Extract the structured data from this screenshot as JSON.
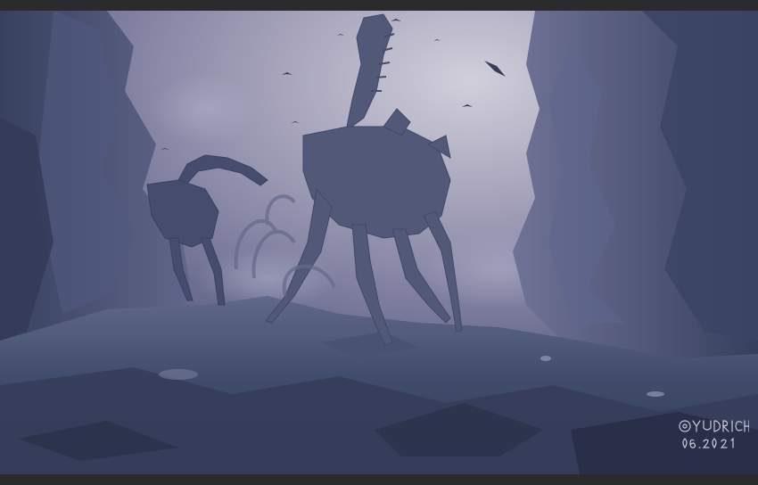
{
  "artwork": {
    "signature_handle": "@YUDRICH",
    "signature_date": "06.2021"
  },
  "colors": {
    "frame": "#2b2b2d",
    "sky_light": "#b9b6c8",
    "sky_mid": "#8784a0",
    "cliff_dark": "#3c4564",
    "ground_dark": "#2c3552",
    "creature": "#4a5070"
  }
}
